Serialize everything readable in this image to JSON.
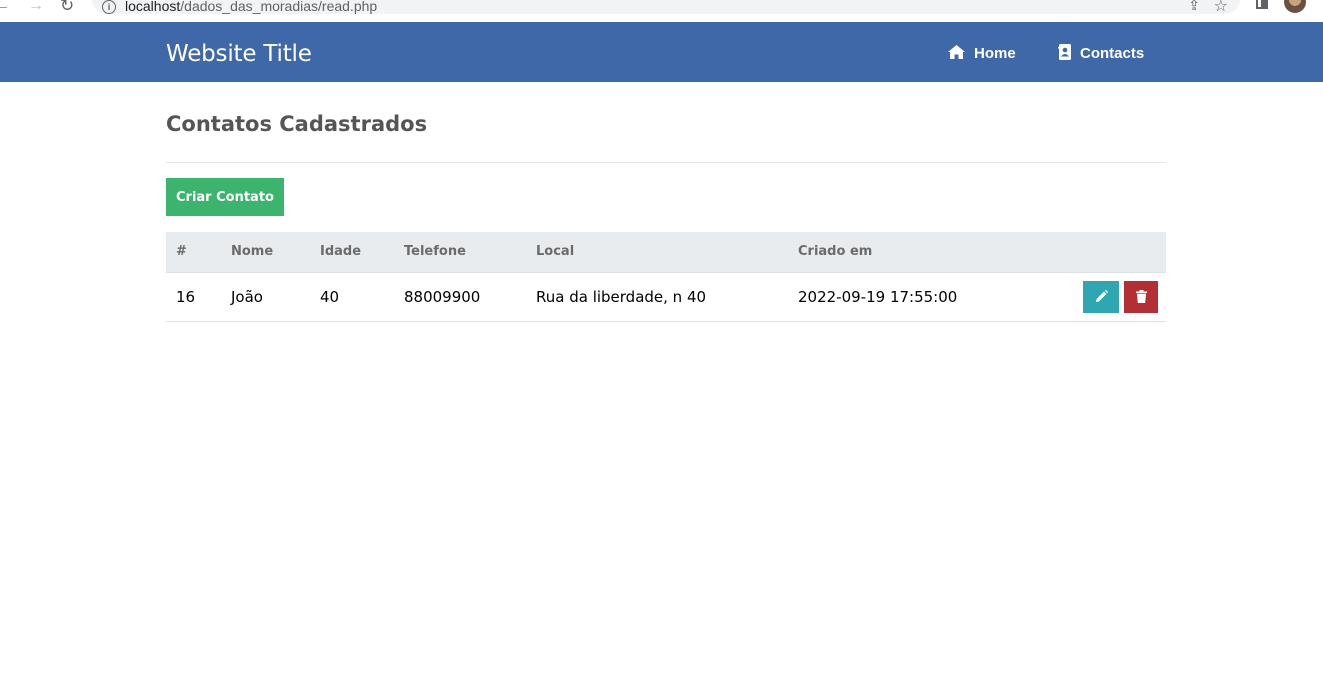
{
  "browser": {
    "url_host": "localhost",
    "url_path": "/dados_das_moradias/read.php"
  },
  "navbar": {
    "title": "Website Title",
    "links": [
      {
        "label": "Home",
        "icon": "home-icon"
      },
      {
        "label": "Contacts",
        "icon": "address-book-icon"
      }
    ],
    "color": "#3e68a8"
  },
  "page": {
    "heading": "Contatos Cadastrados",
    "create_button_label": "Criar Contato",
    "create_button_color": "#3bb56d"
  },
  "table": {
    "columns": [
      "#",
      "Nome",
      "Idade",
      "Telefone",
      "Local",
      "Criado em",
      ""
    ],
    "rows": [
      {
        "id": "16",
        "nome": "João",
        "idade": "40",
        "telefone": "88009900",
        "local": "Rua da liberdade, n 40",
        "criado_em": "2022-09-19 17:55:00",
        "actions": [
          {
            "icon": "pencil-icon",
            "color": "#2fa7b3"
          },
          {
            "icon": "trash-icon",
            "color": "#b32f34"
          }
        ]
      }
    ]
  }
}
